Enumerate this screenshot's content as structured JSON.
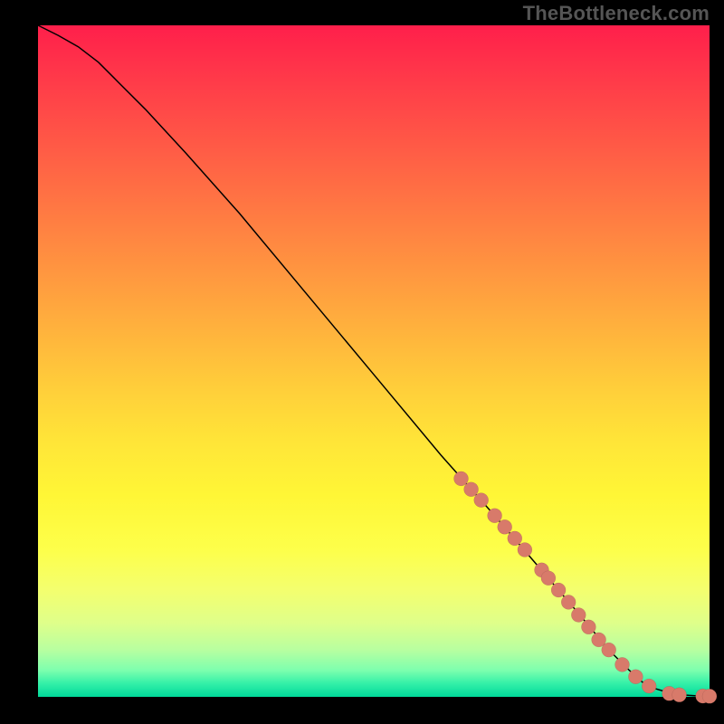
{
  "watermark": "TheBottleneck.com",
  "colors": {
    "dot": "#d87a6a",
    "curve": "#000000",
    "page_bg": "#000000"
  },
  "chart_data": {
    "type": "line",
    "title": "",
    "xlabel": "",
    "ylabel": "",
    "xlim": [
      0,
      100
    ],
    "ylim": [
      0,
      100
    ],
    "grid": false,
    "legend": false,
    "series": [
      {
        "name": "curve",
        "x": [
          0,
          3,
          6,
          9,
          12,
          16,
          22,
          30,
          40,
          50,
          60,
          68,
          74,
          80,
          85,
          88,
          90,
          92,
          94,
          96,
          98,
          100
        ],
        "y": [
          100,
          98.5,
          96.8,
          94.5,
          91.5,
          87.5,
          81,
          72,
          60,
          48,
          36,
          27,
          20,
          13,
          7,
          4,
          2.2,
          1.2,
          0.6,
          0.3,
          0.15,
          0.1
        ]
      }
    ],
    "points": {
      "name": "dots",
      "x": [
        63,
        64.5,
        66,
        68,
        69.5,
        71,
        72.5,
        75,
        76,
        77.5,
        79,
        80.5,
        82,
        83.5,
        85,
        87,
        89,
        91,
        94,
        95.5,
        99,
        100
      ],
      "y": [
        32.5,
        30.9,
        29.3,
        27,
        25.3,
        23.6,
        21.9,
        18.9,
        17.7,
        15.9,
        14.1,
        12.2,
        10.4,
        8.5,
        7,
        4.8,
        3.0,
        1.6,
        0.5,
        0.3,
        0.12,
        0.1
      ]
    }
  }
}
